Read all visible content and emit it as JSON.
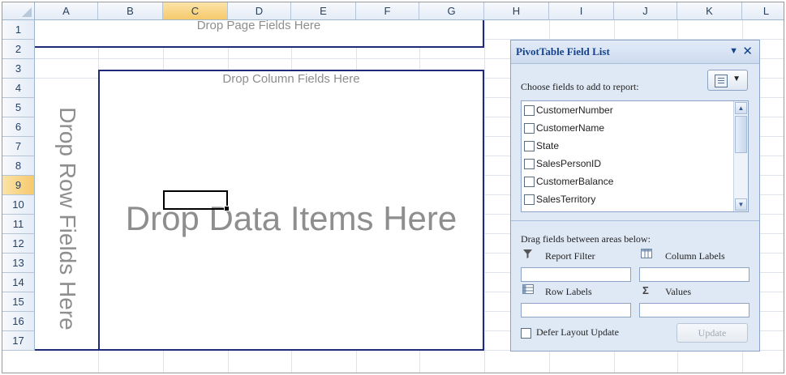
{
  "columns": [
    "A",
    "B",
    "C",
    "D",
    "E",
    "F",
    "G",
    "H",
    "I",
    "J",
    "K",
    "L"
  ],
  "rows": [
    "1",
    "2",
    "3",
    "4",
    "5",
    "6",
    "7",
    "8",
    "9",
    "10",
    "11",
    "12",
    "13",
    "14",
    "15",
    "16",
    "17"
  ],
  "selected_column": "C",
  "selected_row": "9",
  "pivot": {
    "page_zone": "Drop Page Fields Here",
    "column_zone": "Drop Column Fields Here",
    "row_zone": "Drop Row Fields Here",
    "data_zone": "Drop Data Items Here"
  },
  "field_list": {
    "title": "PivotTable Field List",
    "choose_label": "Choose fields to add to report:",
    "fields": [
      "CustomerNumber",
      "CustomerName",
      "State",
      "SalesPersonID",
      "CustomerBalance",
      "SalesTerritory"
    ],
    "drag_label": "Drag fields between areas below:",
    "areas": {
      "report_filter": "Report Filter",
      "column_labels": "Column Labels",
      "row_labels": "Row Labels",
      "values": "Values"
    },
    "defer_label": "Defer Layout Update",
    "update_label": "Update"
  }
}
